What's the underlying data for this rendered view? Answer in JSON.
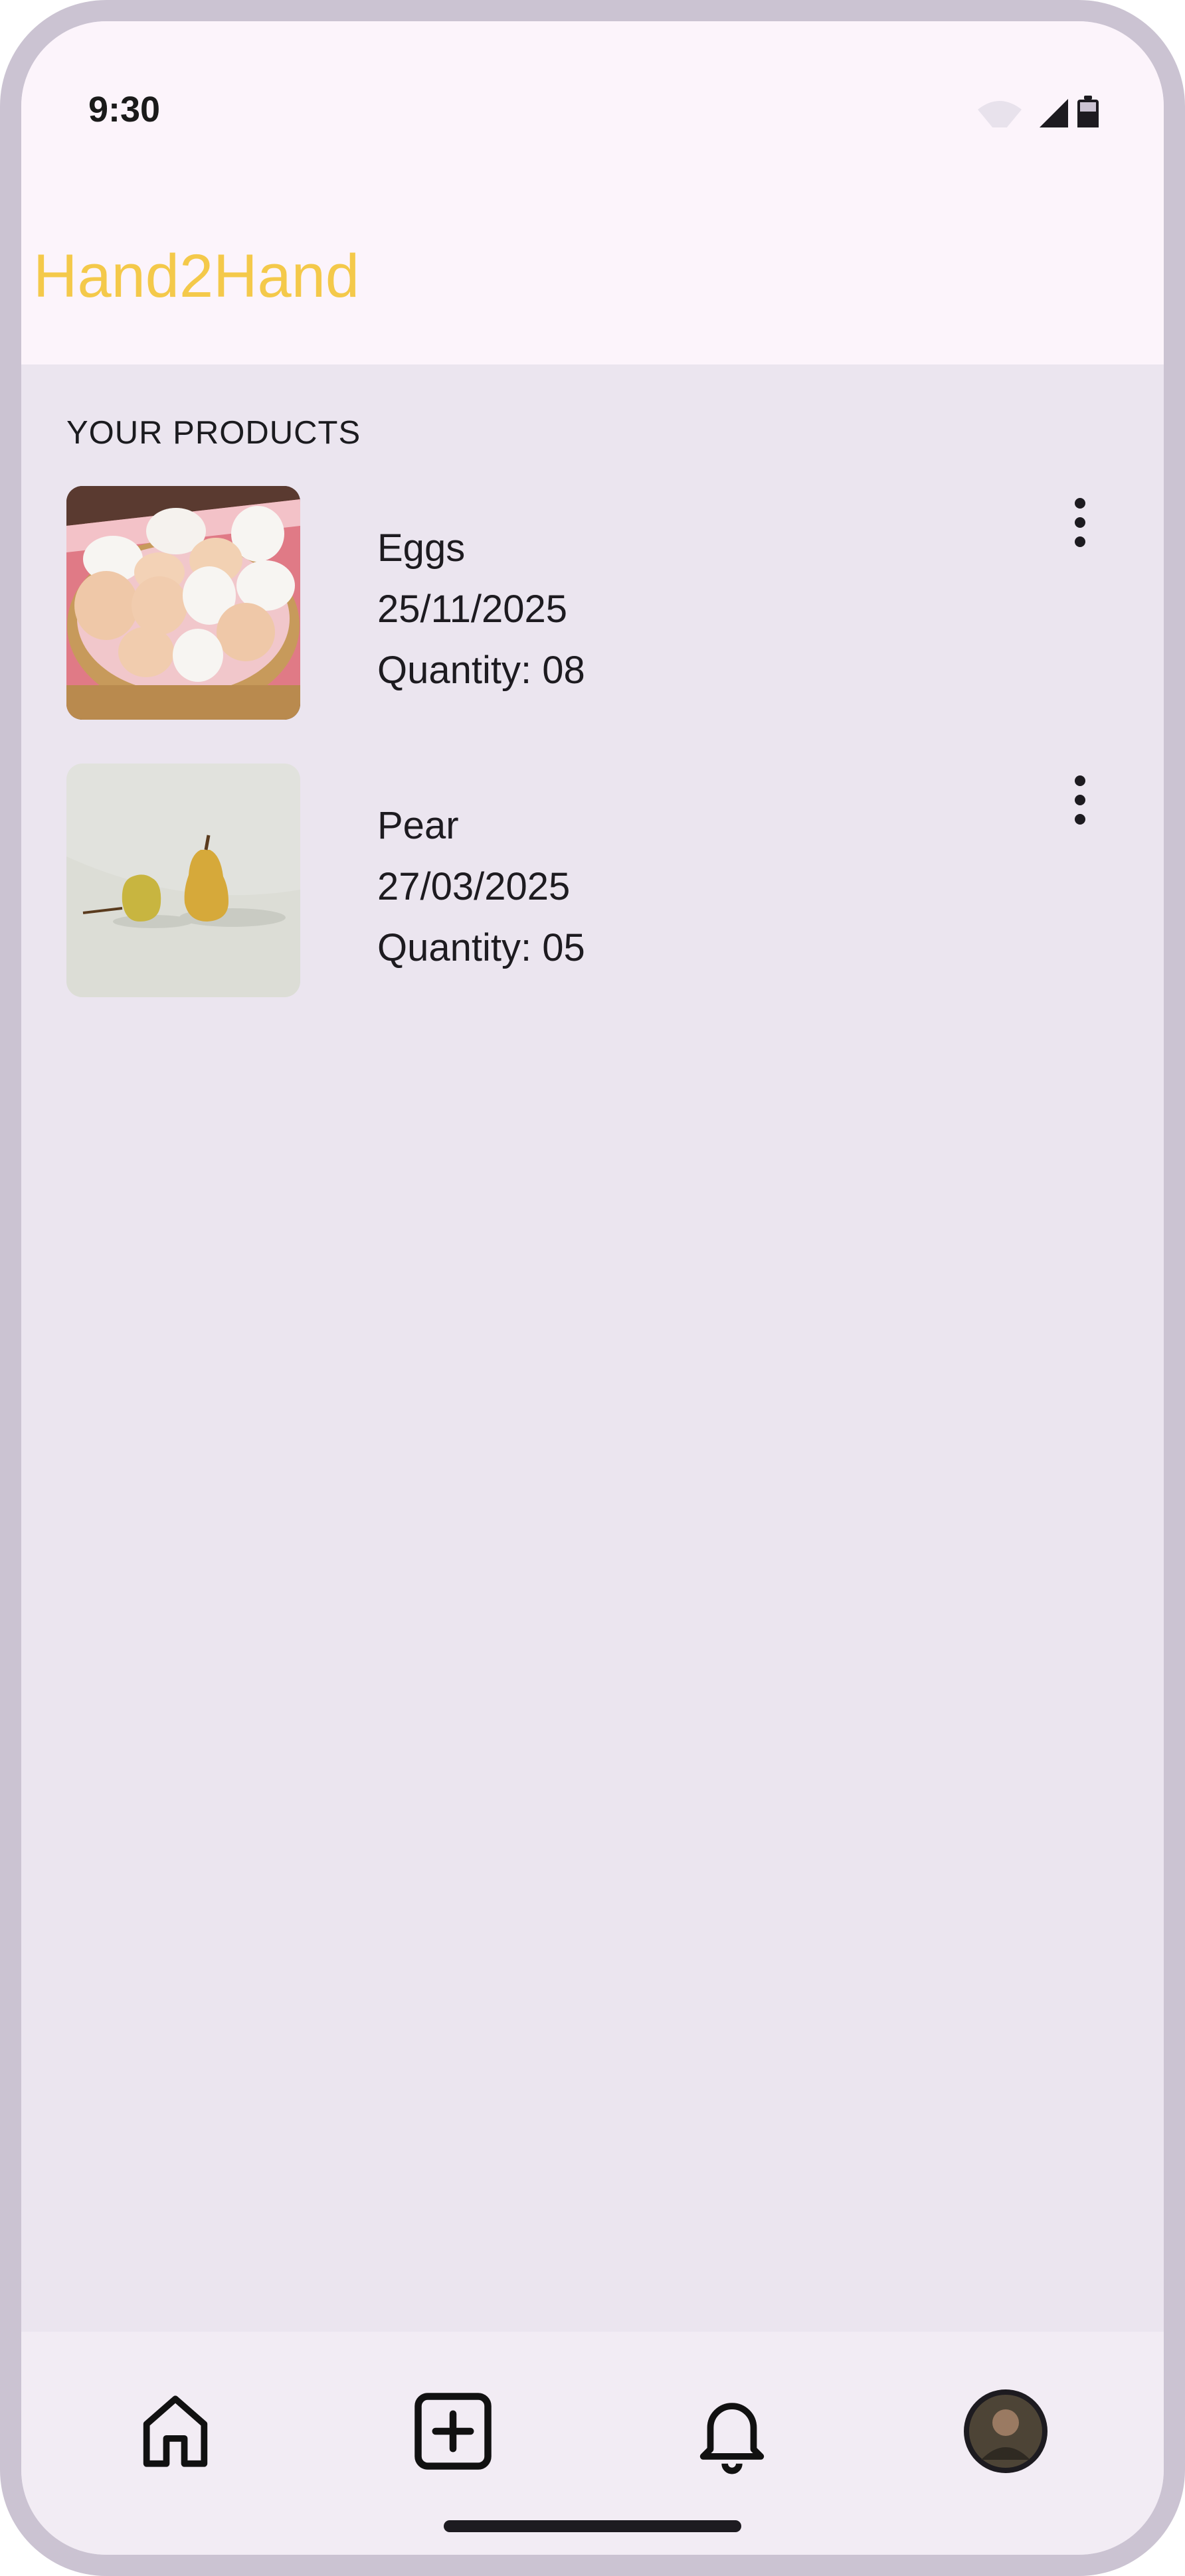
{
  "status_bar": {
    "time": "9:30",
    "icons": [
      "wifi-icon",
      "signal-icon",
      "battery-icon"
    ]
  },
  "app_bar": {
    "title": "Hand2Hand",
    "title_color": "#f4c94a"
  },
  "section": {
    "heading": "YOUR PRODUCTS"
  },
  "products": [
    {
      "name": "Eggs",
      "date": "25/11/2025",
      "quantity": "Quantity: 08",
      "thumbnail": "eggs-in-basket"
    },
    {
      "name": "Pear",
      "date": "27/03/2025",
      "quantity": "Quantity: 05",
      "thumbnail": "two-pears"
    }
  ],
  "bottom_nav": {
    "items": [
      "home-icon",
      "add-product-icon",
      "notifications-bell-icon",
      "profile-avatar"
    ]
  }
}
